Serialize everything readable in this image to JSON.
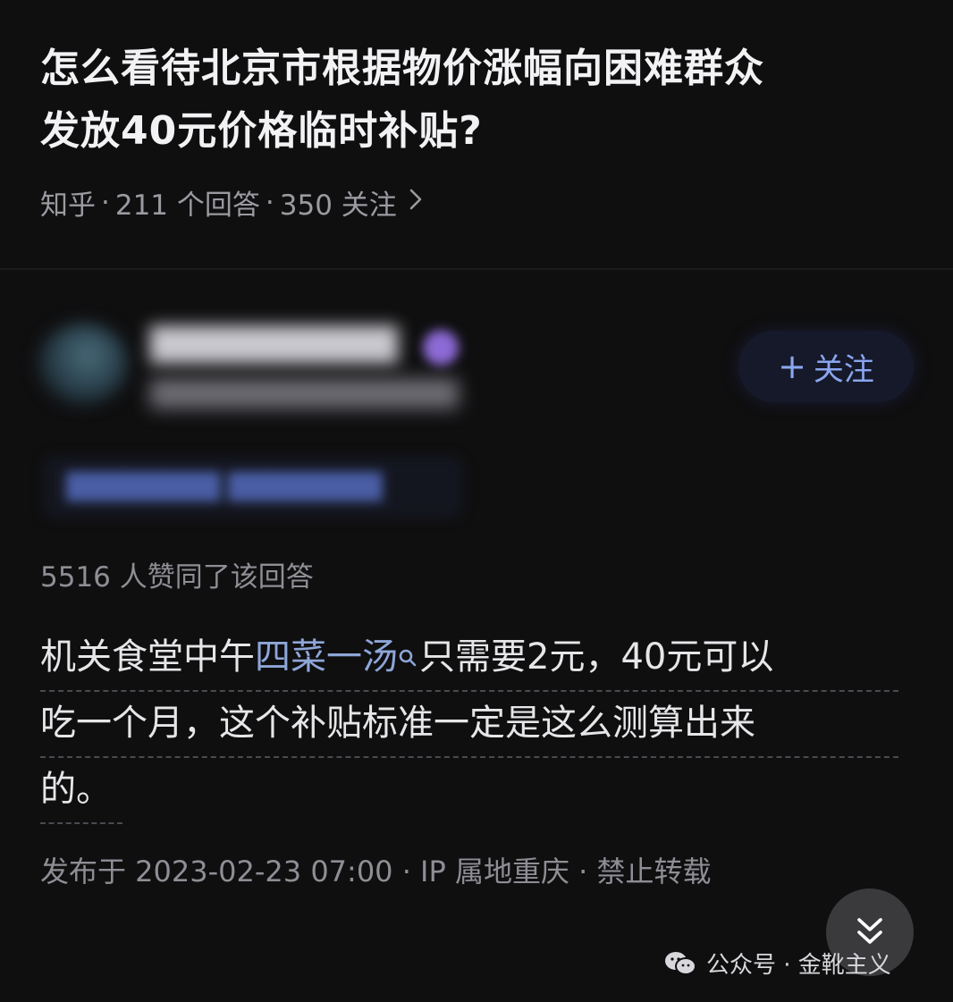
{
  "question": {
    "title_line1": "怎么看待北京市根据物价涨幅向困难群众",
    "title_line2": "发放40元价格临时补贴?",
    "source": "知乎",
    "answers_count": "211 个回答",
    "followers_count": "350 关注",
    "separator": "·",
    "chevron_icon": "chevron-right-icon"
  },
  "author": {
    "follow_label": "关注",
    "plus_icon": "plus-icon"
  },
  "answer": {
    "likes_text": "5516 人赞同了该回答",
    "line1_before": "机关食堂中午",
    "line1_keyword": "四菜一汤",
    "line1_after": "只需要2元，40元可以",
    "line2": "吃一个月，这个补贴标准一定是这么测算出来",
    "line3": "的。",
    "keyword_icon": "search-icon",
    "footer": "发布于 2023-02-23 07:00 · IP 属地重庆 · 禁止转载"
  },
  "scroll_button": {
    "icon": "double-chevron-down-icon"
  },
  "watermark": {
    "text": "公众号 · 金靴主义",
    "icon": "wechat-icon"
  },
  "colors": {
    "background": "#0f0f10",
    "keyword": "#8ea6d8",
    "follow_text": "#8aa6ef",
    "follow_bg": "#16192a",
    "meta_text": "#8e8e95"
  }
}
